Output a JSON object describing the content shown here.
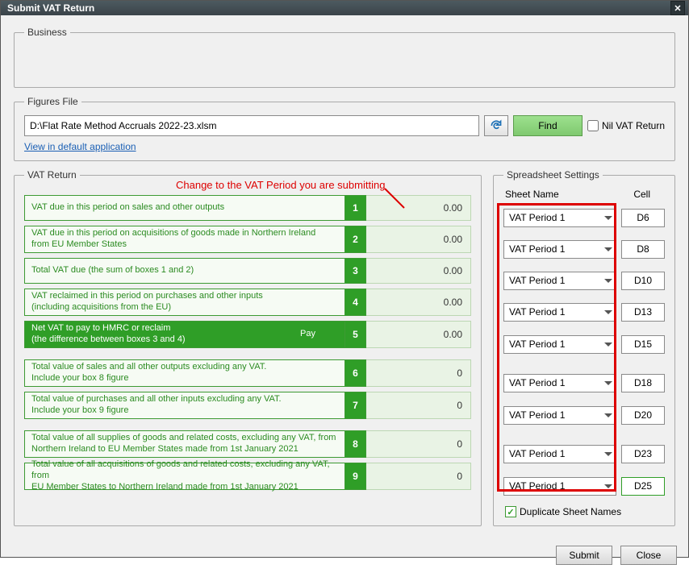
{
  "dialog": {
    "title": "Submit VAT Return"
  },
  "business": {
    "legend": "Business"
  },
  "figures": {
    "legend": "Figures File",
    "path": "D:\\Flat Rate Method Accruals 2022-23.xlsm",
    "find": "Find",
    "nil_label": "Nil VAT Return",
    "nil_checked": false,
    "view_link": "View in default application"
  },
  "annotation": "Change to the VAT Period you are submitting",
  "vat_return": {
    "legend": "VAT Return",
    "lines": [
      {
        "num": "1",
        "desc1": "VAT due in this period on sales and other outputs",
        "desc2": "",
        "value": "0.00",
        "highlight": false
      },
      {
        "num": "2",
        "desc1": "VAT due in this period on acquisitions of goods made in Northern Ireland",
        "desc2": "from EU Member States",
        "value": "0.00",
        "highlight": false
      },
      {
        "num": "3",
        "desc1": "Total VAT due (the sum of boxes 1 and 2)",
        "desc2": "",
        "value": "0.00",
        "highlight": false
      },
      {
        "num": "4",
        "desc1": "VAT reclaimed in this period on purchases and other inputs",
        "desc2": "(including acquisitions from the EU)",
        "value": "0.00",
        "highlight": false
      },
      {
        "num": "5",
        "desc1": "Net VAT to pay to HMRC or reclaim",
        "desc2": "(the difference between boxes 3 and 4)",
        "value": "0.00",
        "highlight": true,
        "pay": "Pay"
      },
      {
        "num": "6",
        "desc1": "Total value of sales and all other outputs excluding any VAT.",
        "desc2": "Include your box 8 figure",
        "value": "0",
        "highlight": false
      },
      {
        "num": "7",
        "desc1": "Total value of purchases and all other inputs excluding any VAT.",
        "desc2": "Include your box 9 figure",
        "value": "0",
        "highlight": false
      },
      {
        "num": "8",
        "desc1": "Total value of all supplies of goods and related costs, excluding any VAT, from",
        "desc2": "Northern Ireland to EU Member States made from 1st January 2021",
        "value": "0",
        "highlight": false
      },
      {
        "num": "9",
        "desc1": "Total value of all acquisitions of goods and related costs, excluding any VAT, from",
        "desc2": "EU Member States to Northern Ireland made from 1st January 2021",
        "value": "0",
        "highlight": false
      }
    ]
  },
  "spreadsheet": {
    "legend": "Spreadsheet Settings",
    "sheet_header": "Sheet Name",
    "cell_header": "Cell",
    "rows": [
      {
        "sheet": "VAT Period 1",
        "cell": "D6"
      },
      {
        "sheet": "VAT Period 1",
        "cell": "D8"
      },
      {
        "sheet": "VAT Period 1",
        "cell": "D10"
      },
      {
        "sheet": "VAT Period 1",
        "cell": "D13"
      },
      {
        "sheet": "VAT Period 1",
        "cell": "D15"
      },
      {
        "sheet": "VAT Period 1",
        "cell": "D18"
      },
      {
        "sheet": "VAT Period 1",
        "cell": "D20"
      },
      {
        "sheet": "VAT Period 1",
        "cell": "D23"
      },
      {
        "sheet": "VAT Period 1",
        "cell": "D25"
      }
    ],
    "dup_label": "Duplicate Sheet Names",
    "dup_checked": true
  },
  "footer": {
    "submit": "Submit",
    "close": "Close"
  }
}
